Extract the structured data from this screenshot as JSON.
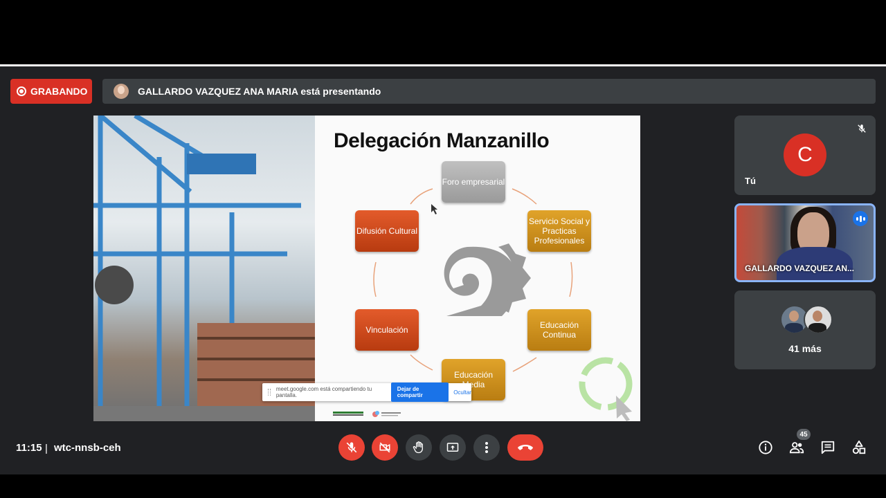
{
  "recording": {
    "label": "GRABANDO"
  },
  "presenter_bar": {
    "text": "GALLARDO VAZQUEZ ANA MARIA está presentando"
  },
  "slide": {
    "title": "Delegación Manzanillo",
    "nodes": {
      "foro": "Foro empresarial",
      "servicio": "Servicio Social y Practicas Profesionales",
      "educacion_continua": "Educación Continua",
      "educacion_media": "Educación Media",
      "vinculacion": "Vinculación",
      "difusion": "Difusión Cultural"
    },
    "share_bar": {
      "message": "meet.google.com está compartiendo tu pantalla.",
      "stop_label": "Dejar de compartir",
      "hide_label": "Ocultar"
    }
  },
  "tiles": {
    "you": {
      "initial": "C",
      "name": "Tú"
    },
    "presenter": {
      "name": "GALLARDO VAZQUEZ AN..."
    },
    "more": {
      "label": "41 más"
    }
  },
  "bottom_bar": {
    "time": "11:15",
    "separator": "|",
    "meeting_code": "wtc-nnsb-ceh",
    "participants_count": "45"
  },
  "colors": {
    "meet_bg": "#202124",
    "tile_bg": "#3c4043",
    "danger": "#ea4335",
    "recording": "#d93025",
    "accent": "#8ab4f8"
  }
}
